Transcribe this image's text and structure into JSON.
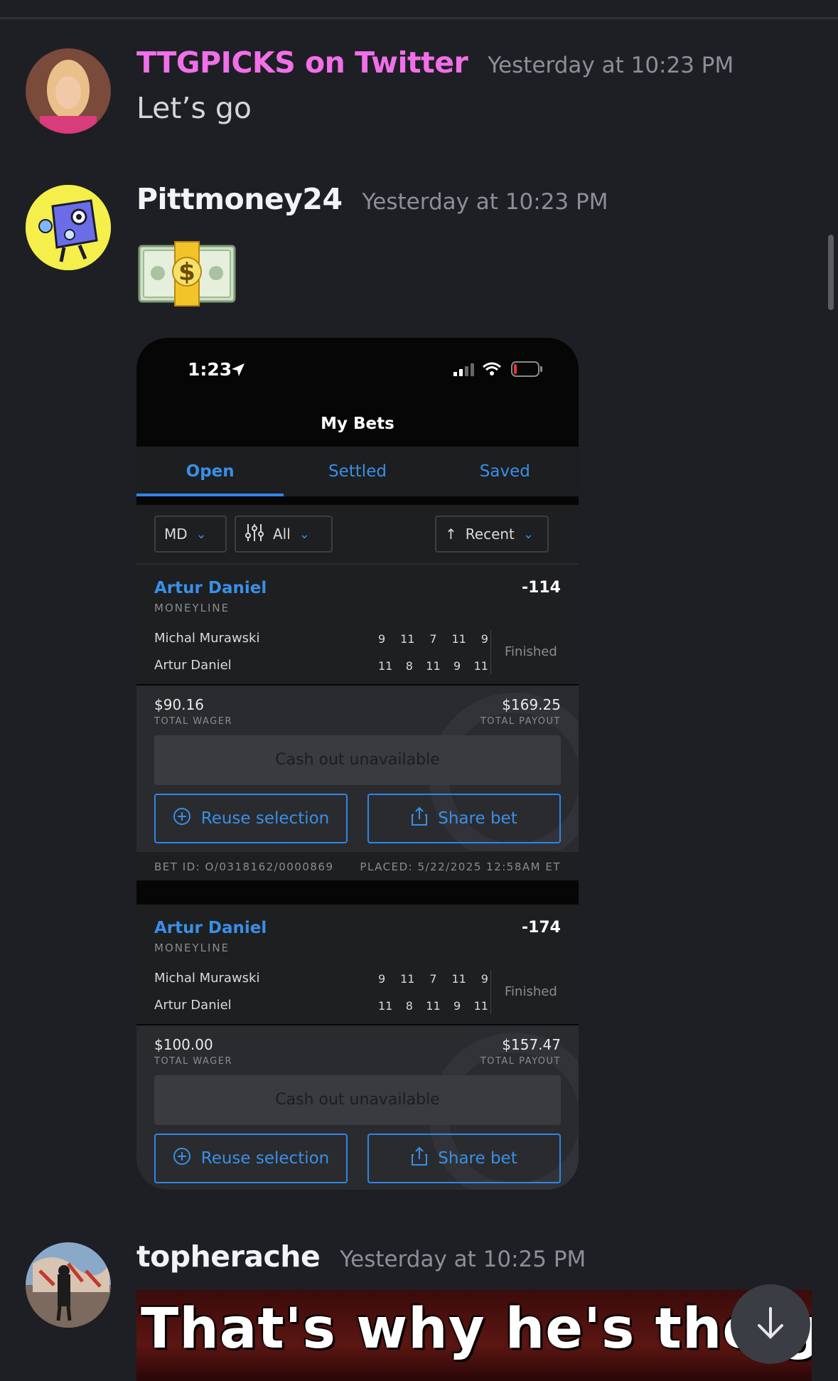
{
  "messages": [
    {
      "author": "TTGPICKS on Twitter",
      "time": "Yesterday at 10:23 PM",
      "text": "Let’s go",
      "author_color": "#f16fe9"
    },
    {
      "author": "Pittmoney24",
      "time": "Yesterday at 10:23 PM",
      "emoji": "money-with-wings-banknote"
    },
    {
      "author": "topherache",
      "time": "Yesterday at 10:25 PM",
      "image_text": "That's why he's the go"
    }
  ],
  "phone": {
    "time": "1:23",
    "title": "My Bets",
    "tabs": [
      "Open",
      "Settled",
      "Saved"
    ],
    "active_tab": "Open",
    "filters": {
      "state": "MD",
      "sport": "All",
      "sort": "Recent"
    },
    "bets": [
      {
        "name": "Artur Daniel",
        "type": "MONEYLINE",
        "odds": "-114",
        "players": [
          {
            "name": "Michal Murawski",
            "scores": [
              "9",
              "11",
              "7",
              "11",
              "9"
            ]
          },
          {
            "name": "Artur Daniel",
            "scores": [
              "11",
              "8",
              "11",
              "9",
              "11"
            ]
          }
        ],
        "status": "Finished",
        "wager": "$90.16",
        "wager_label": "TOTAL WAGER",
        "payout": "$169.25",
        "payout_label": "TOTAL PAYOUT",
        "cashout": "Cash out unavailable",
        "reuse": "Reuse selection",
        "share": "Share bet",
        "bet_id": "BET ID: O/0318162/0000869",
        "placed": "PLACED: 5/22/2025 12:58AM ET"
      },
      {
        "name": "Artur Daniel",
        "type": "MONEYLINE",
        "odds": "-174",
        "players": [
          {
            "name": "Michal Murawski",
            "scores": [
              "9",
              "11",
              "7",
              "11",
              "9"
            ]
          },
          {
            "name": "Artur Daniel",
            "scores": [
              "11",
              "8",
              "11",
              "9",
              "11"
            ]
          }
        ],
        "status": "Finished",
        "wager": "$100.00",
        "wager_label": "TOTAL WAGER",
        "payout": "$157.47",
        "payout_label": "TOTAL PAYOUT",
        "cashout": "Cash out unavailable",
        "reuse": "Reuse selection",
        "share": "Share bet"
      }
    ]
  },
  "colors": {
    "background": "#1e1f24",
    "accent_blue": "#3a8fe6",
    "username_pink": "#f16fe9"
  }
}
